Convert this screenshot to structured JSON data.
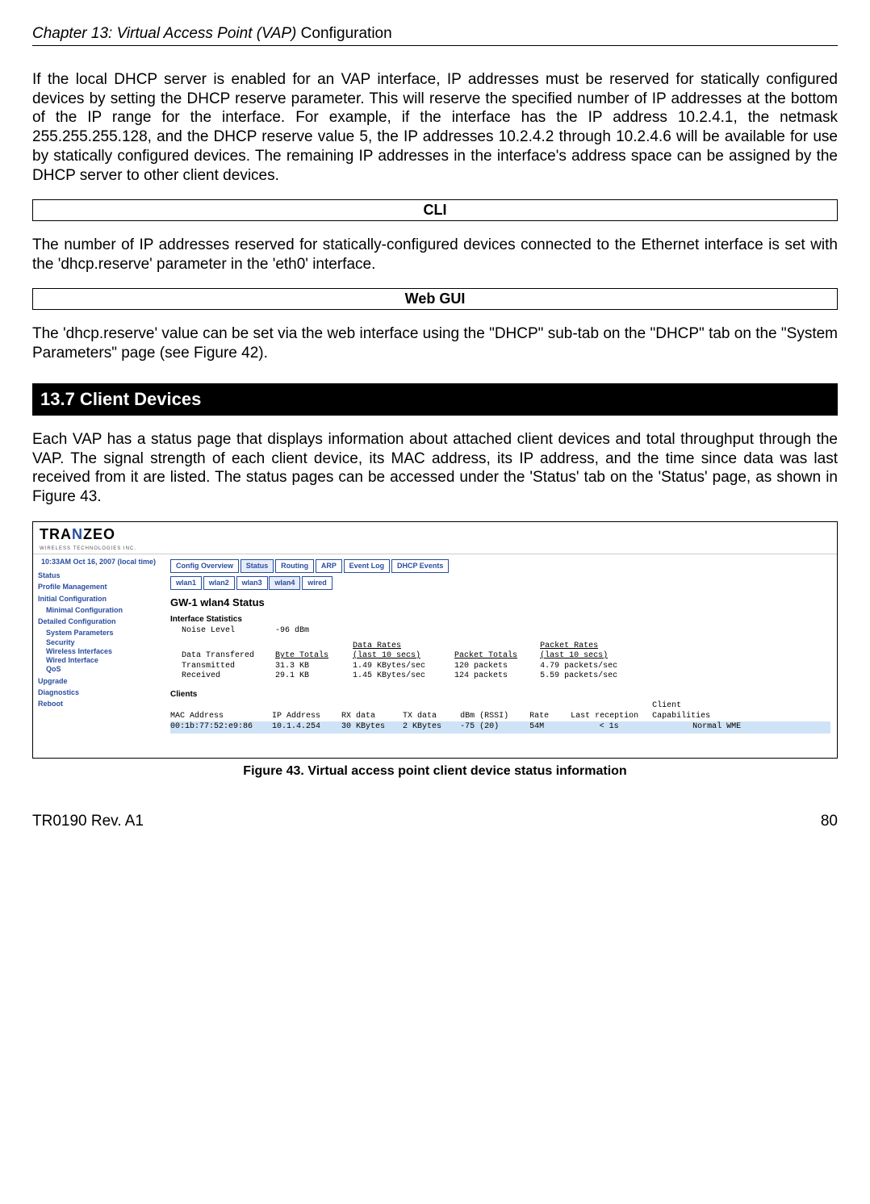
{
  "header": {
    "chapter": "Chapter 13: Virtual Access Point (VAP) ",
    "tail": "Configuration"
  },
  "p1": "If the local DHCP server is enabled for an VAP interface, IP addresses must be reserved for statically configured devices by setting the DHCP reserve parameter. This will reserve the specified number of IP addresses at the bottom of the IP range for the interface. For example, if the interface has the IP address 10.2.4.1, the netmask 255.255.255.128, and the DHCP reserve value 5, the IP addresses 10.2.4.2 through 10.2.4.6 will be available for use by statically configured devices. The remaining IP addresses in the interface's address space can be assigned by the DHCP server to other client devices.",
  "box_cli": "CLI",
  "p2": "The number of IP addresses reserved for statically-configured devices connected to the Ethernet interface is set with the 'dhcp.reserve' parameter in the 'eth0' interface.",
  "box_web": "Web GUI",
  "p3": "The 'dhcp.reserve' value can be set via the web interface using the \"DHCP\" sub-tab on the \"DHCP\" tab on the \"System Parameters\" page (see Figure 42).",
  "section": "13.7    Client Devices",
  "p4": "Each VAP has a status page that displays information about attached client devices and total throughput through the VAP. The signal strength of each client device, its MAC address, its IP address, and the time since data was last received from it are listed. The status pages can be accessed under the 'Status' tab on the 'Status' page, as shown in Figure 43.",
  "screenshot": {
    "logo_main_pre": "TRA",
    "logo_main_accent": "N",
    "logo_main_post": "ZEO",
    "logo_sub": "WIRELESS TECHNOLOGIES INC.",
    "clock": "10:33AM Oct 16, 2007 (local time)",
    "nav": [
      "Status",
      "Profile Management",
      "Initial Configuration",
      "Minimal Configuration",
      "Detailed Configuration",
      "System Parameters",
      "Security",
      "Wireless Interfaces",
      "Wired Interface",
      "QoS",
      "Upgrade",
      "Diagnostics",
      "Reboot"
    ],
    "tabs_top": [
      "Config Overview",
      "Status",
      "Routing",
      "ARP",
      "Event Log",
      "DHCP Events"
    ],
    "tabs_sub": [
      "wlan1",
      "wlan2",
      "wlan3",
      "wlan4",
      "wired"
    ],
    "title": "GW-1 wlan4 Status",
    "interface_stats_label": "Interface Statistics",
    "noise_label": "Noise Level",
    "noise_value": "-96 dBm",
    "dt_label": "Data Transfered",
    "cols": {
      "bytes": "Byte Totals",
      "drates": "Data Rates",
      "drates_sub": "(last 10 secs)",
      "pkts": "Packet Totals",
      "prates": "Packet Rates",
      "prates_sub": "(last 10 secs)"
    },
    "tx": {
      "label": "Transmitted",
      "bytes": "31.3 KB",
      "drate": "1.49 KBytes/sec",
      "pkts": "120 packets",
      "prate": "4.79 packets/sec"
    },
    "rx": {
      "label": "Received",
      "bytes": "29.1 KB",
      "drate": "1.45 KBytes/sec",
      "pkts": "124 packets",
      "prate": "5.59 packets/sec"
    },
    "clients_label": "Clients",
    "client_cols": [
      "MAC Address",
      "IP Address",
      "RX data",
      "TX data",
      "dBm (RSSI)",
      "Rate",
      "Last reception",
      "Client Capabilities"
    ],
    "client_row": [
      "00:1b:77:52:e9:86",
      "10.1.4.254",
      "30 KBytes",
      "2 KBytes",
      "-75 (20)",
      "54M",
      "< 1s",
      "Normal WME"
    ]
  },
  "figure_caption": "Figure 43. Virtual access point client device status information",
  "footer": {
    "left": "TR0190 Rev. A1",
    "right": "80"
  }
}
